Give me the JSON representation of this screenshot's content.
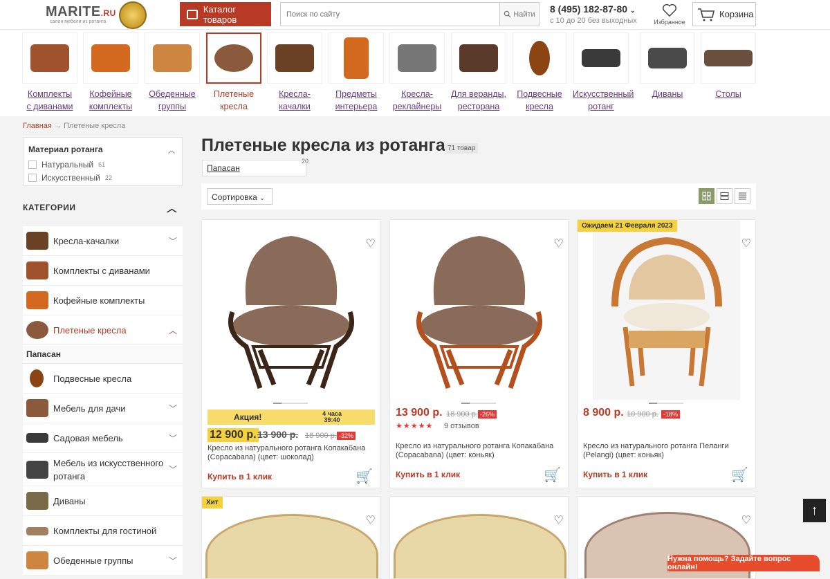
{
  "header": {
    "logo_text": "MARITE",
    "logo_ru": ".RU",
    "logo_sub": "салон мебели из ротанга",
    "catalog_label": "Каталог товаров",
    "search_placeholder": "Поиск по сайту",
    "search_button": "Найти",
    "phone": "8 (495) 182-87-80",
    "hours": "с 10 до 20 без выходных",
    "favorites": "Избранное",
    "cart": "Корзина"
  },
  "categories": [
    {
      "label1": "Комплекты",
      "label2": "с диванами",
      "color": "#a0522d"
    },
    {
      "label1": "Кофейные",
      "label2": "комплекты",
      "color": "#d2691e"
    },
    {
      "label1": "Обеденные",
      "label2": "группы",
      "color": "#cd853f"
    },
    {
      "label1": "Плетеные",
      "label2": "кресла",
      "color": "#8b5a3c"
    },
    {
      "label1": "Кресла-",
      "label2": "качалки",
      "color": "#6b4226"
    },
    {
      "label1": "Предметы",
      "label2": "интерьера",
      "color": "#d2691e"
    },
    {
      "label1": "Кресла-",
      "label2": "реклайнеры",
      "color": "#777777"
    },
    {
      "label1": "Для веранды,",
      "label2": "ресторана",
      "color": "#5a3a2a"
    },
    {
      "label1": "Подвесные",
      "label2": "кресла",
      "color": "#8b4513"
    },
    {
      "label1": "Искусственный",
      "label2": "ротанг",
      "color": "#3a3a3a"
    },
    {
      "label1": "Диваны",
      "label2": "",
      "color": "#4a4a4a"
    },
    {
      "label1": "Столы",
      "label2": "",
      "color": "#6b5040"
    }
  ],
  "breadcrumb": {
    "home": "Главная",
    "arrow": "→",
    "current": "Плетеные кресла"
  },
  "filter": {
    "title": "Материал ротанга",
    "options": [
      {
        "label": "Натуральный",
        "count": "61"
      },
      {
        "label": "Искусственный",
        "count": "22"
      }
    ]
  },
  "sidebar": {
    "heading": "КАТЕГОРИИ",
    "items": [
      {
        "label": "Кресла-качалки",
        "color": "#6b4226"
      },
      {
        "label": "Комплекты с диванами",
        "color": "#a0522d"
      },
      {
        "label": "Кофейные комплекты",
        "color": "#d2691e"
      },
      {
        "label": "Плетеные кресла",
        "color": "#8b5a3c"
      },
      {
        "label": "Папасан"
      },
      {
        "label": "Подвесные кресла",
        "color": "#8b4513"
      },
      {
        "label": "Мебель для дачи",
        "color": "#8b5a3c"
      },
      {
        "label": "Садовая мебель",
        "color": "#3a3a3a"
      },
      {
        "label": "Мебель из искусственного ротанга",
        "color": "#444444"
      },
      {
        "label": "Диваны",
        "color": "#7a6a4a"
      },
      {
        "label": "Комплекты для гостиной",
        "color": "#a08060"
      },
      {
        "label": "Обеденные группы",
        "color": "#cd853f"
      }
    ]
  },
  "main": {
    "title": "Плетеные кресла из ротанга",
    "count": "71 товар",
    "tag": "Папасан",
    "tag_count": "20",
    "sort": "Сортировка"
  },
  "products": [
    {
      "promo": "Акция!",
      "timer1": "4 часа",
      "timer2": "39:40",
      "price": "12 900 р.",
      "old1": "13 900 р.",
      "old2": "18 900 р.",
      "disc": "-32%",
      "name": "Кресло из натурального ротанга Копакабана (Copacabana) (цвет: шоколад)",
      "buy": "Купить в 1 клик",
      "frame": "#3b2418",
      "cushion": "#8a6a58"
    },
    {
      "price": "13 900 р.",
      "old1": "18 900 р.",
      "disc": "-26%",
      "stars": "★★★★★",
      "reviews": "9 отзывов",
      "name": "Кресло из натурального ротанга Копакабана (Copacabana) (цвет: коньяк)",
      "buy": "Купить в 1 клик",
      "frame": "#b4501e",
      "cushion": "#8a6a58"
    },
    {
      "badge": "Ожидаем 21 Февраля 2023",
      "price": "8 900 р.",
      "old1": "10 900 р.",
      "disc": "-18%",
      "name": "Кресло из натурального ротанга Пеланги (Pelangi) (цвет: коньяк)",
      "buy": "Купить в 1 клик",
      "frame": "#c87833",
      "cushion": "#efe8d8"
    }
  ],
  "row2": [
    {
      "badge": "Хит"
    },
    {},
    {}
  ],
  "totop": "↑",
  "help": "Нужна помощь? Задайте вопрос онлайн!"
}
